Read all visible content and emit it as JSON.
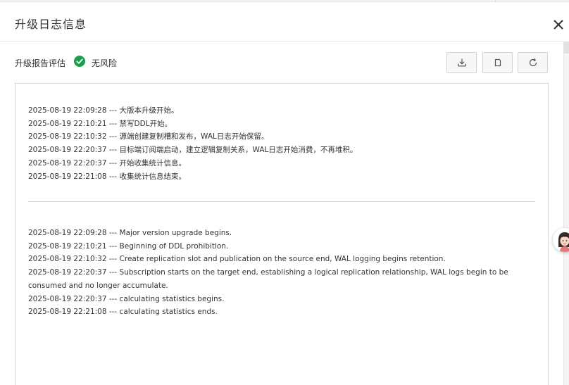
{
  "dialog": {
    "title": "升级日志信息",
    "close_icon": "close-icon"
  },
  "toolbar": {
    "eval_label": "升级报告评估",
    "status_icon": "check-circle-icon",
    "status_color": "#1a9e4b",
    "status_text": "无风险",
    "buttons": [
      {
        "name": "download-button",
        "icon": "download-icon"
      },
      {
        "name": "copy-button",
        "icon": "copy-icon"
      },
      {
        "name": "refresh-button",
        "icon": "refresh-icon"
      }
    ]
  },
  "log": {
    "cn_lines": [
      "2025-08-19 22:09:28 --- 大版本升级开始。",
      "2025-08-19 22:10:21 --- 禁写DDL开始。",
      "2025-08-19 22:10:32 --- 源端创建复制槽和发布，WAL日志开始保留。",
      "2025-08-19 22:20:37 --- 目标端订阅端启动，建立逻辑复制关系，WAL日志开始消费，不再堆积。",
      "2025-08-19 22:20:37 --- 开始收集统计信息。",
      "2025-08-19 22:21:08 --- 收集统计信息结束。"
    ],
    "en_lines": [
      "2025-08-19 22:09:28 --- Major version upgrade begins.",
      "2025-08-19 22:10:21 --- Beginning of DDL prohibition.",
      "2025-08-19 22:10:32 --- Create replication slot and publication on the source end, WAL logging begins retention.",
      "2025-08-19 22:20:37 --- Subscription starts on the target end, establishing a logical replication relationship, WAL logs begin to be",
      "consumed and no longer accumulate.",
      "2025-08-19 22:20:37 --- calculating statistics begins.",
      "2025-08-19 22:21:08 --- calculating statistics ends."
    ]
  },
  "assistant": {
    "icon": "assistant-avatar-icon"
  }
}
